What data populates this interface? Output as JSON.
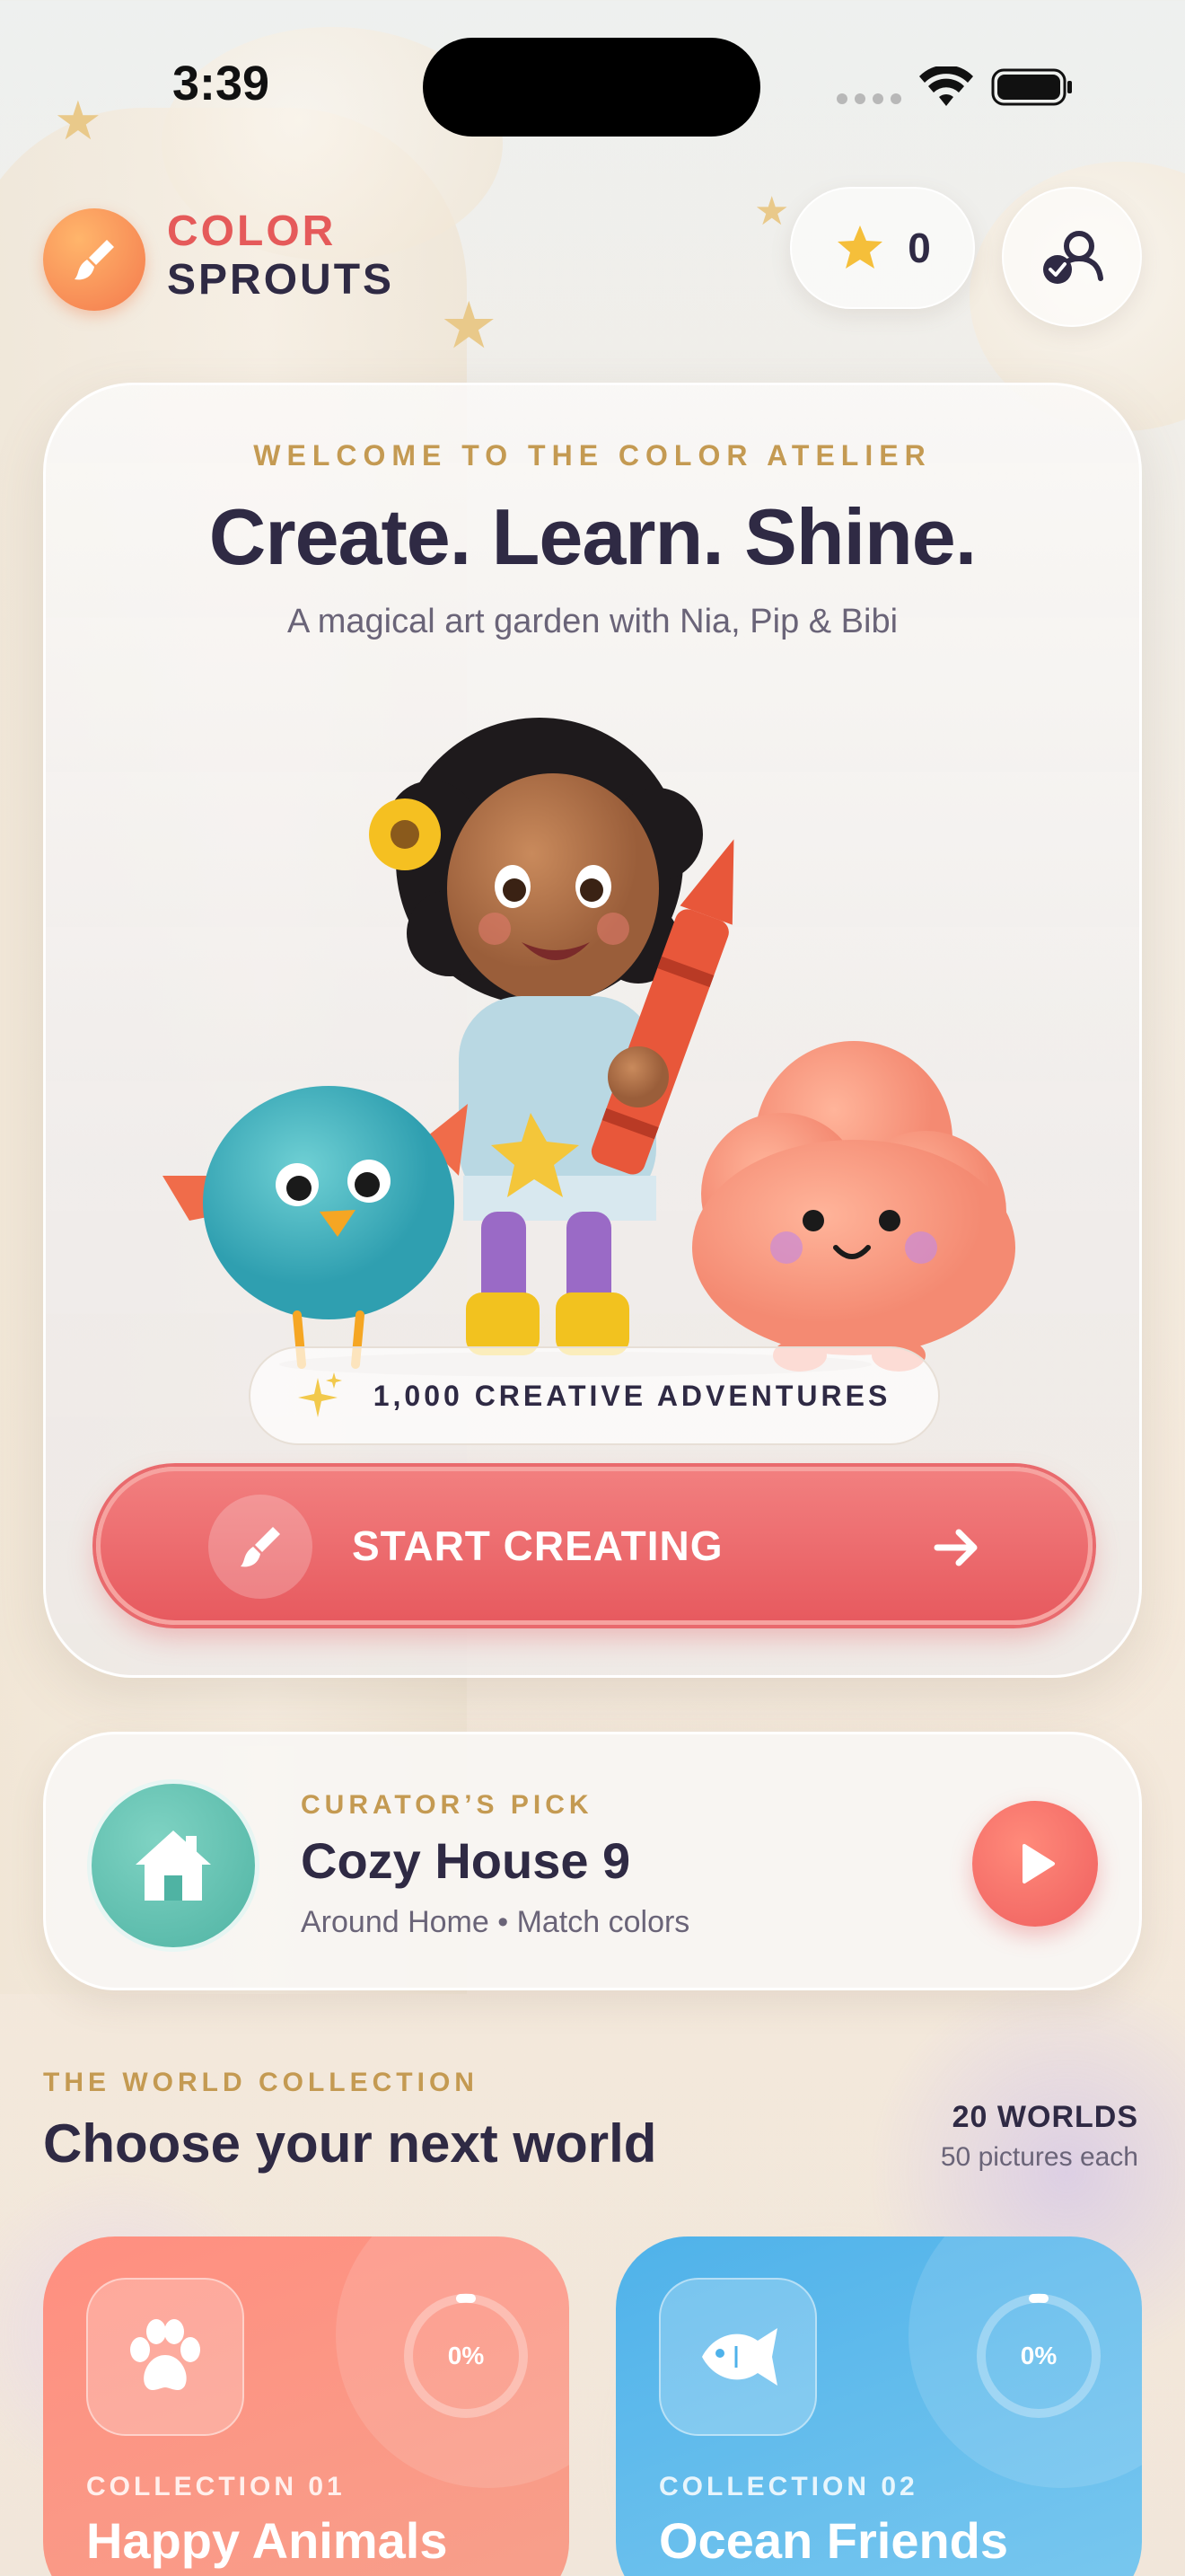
{
  "status_bar": {
    "time": "3:39"
  },
  "header": {
    "logo_line1": "COLOR",
    "logo_line2": "SPROUTS",
    "stars_count": "0",
    "logo_icon": "paintbrush-icon",
    "profile_icon": "profile-switch-icon"
  },
  "hero": {
    "eyebrow": "WELCOME TO THE COLOR ATELIER",
    "title": "Create. Learn. Shine.",
    "subtitle": "A magical art garden with Nia, Pip & Bibi",
    "adventures_label": "1,000 CREATIVE ADVENTURES",
    "start_label": "START CREATING"
  },
  "curator": {
    "eyebrow": "CURATOR’S PICK",
    "title": "Cozy House 9",
    "meta": "Around Home • Match colors",
    "icon": "house-icon"
  },
  "worlds": {
    "eyebrow": "THE WORLD COLLECTION",
    "title": "Choose your next world",
    "count_main": "20 WORLDS",
    "count_sub": "50 pictures each",
    "collections": [
      {
        "eyebrow": "COLLECTION 01",
        "name": "Happy Animals",
        "progress_label": "0%",
        "progress": 0,
        "icon": "paw-icon",
        "color": "#ff8f80"
      },
      {
        "eyebrow": "COLLECTION 02",
        "name": "Ocean Friends",
        "progress_label": "0%",
        "progress": 0,
        "icon": "fish-icon",
        "color": "#4fb2ea"
      }
    ]
  },
  "colors": {
    "accent_red": "#e75a5f",
    "accent_gold": "#c49a52",
    "text_dark": "#2f2a44",
    "teal": "#4fb3a3"
  }
}
